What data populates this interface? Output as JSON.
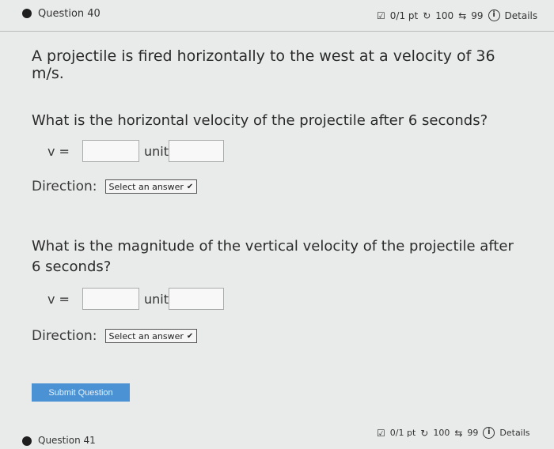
{
  "question40": {
    "title": "Question 40",
    "score": "0/1 pt",
    "attempts": "100",
    "retries": "99",
    "details": "Details"
  },
  "prompt": "A projectile is fired horizontally to the west at a velocity of 36 m/s.",
  "parts": [
    {
      "question": "What is the horizontal velocity of the projectile after 6 seconds?",
      "var_label": "v =",
      "value": "",
      "unit_label": "unit",
      "unit_value": "",
      "direction_label": "Direction:",
      "direction_select": "Select an answer"
    },
    {
      "question": "What is the magnitude of the vertical velocity of the projectile after 6 seconds?",
      "var_label": "v =",
      "value": "",
      "unit_label": "unit",
      "unit_value": "",
      "direction_label": "Direction:",
      "direction_select": "Select an answer"
    }
  ],
  "submit_label": "Submit Question",
  "question41": {
    "title": "Question 41",
    "score": "0/1 pt",
    "attempts": "100",
    "retries": "99",
    "details": "Details"
  },
  "colors": {
    "background": "#e9ebea",
    "accent": "#4a92d4",
    "text": "#2a2a2a"
  },
  "icons": [
    "check-box-icon",
    "history-icon",
    "retry-icon",
    "info-icon",
    "chevron-down-icon"
  ]
}
